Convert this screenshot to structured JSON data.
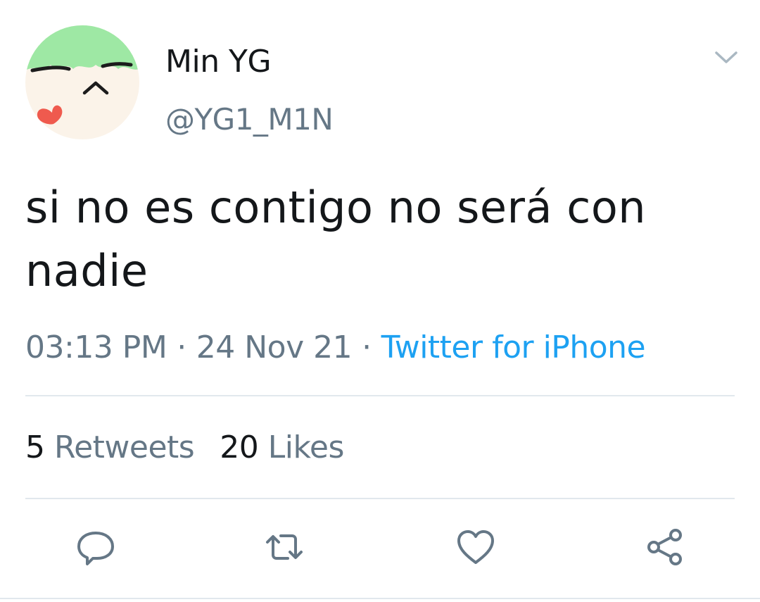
{
  "tweet": {
    "display_name": "Min YG",
    "handle": "@YG1_M1N",
    "text": "si no es contigo no será con nadie",
    "time": "03:13 PM",
    "date": "24 Nov 21",
    "separator": "·",
    "source": "Twitter for iPhone",
    "retweets_count": "5",
    "retweets_label": "Retweets",
    "likes_count": "20",
    "likes_label": "Likes"
  },
  "icons": {
    "avatar": "avatar-image",
    "menu": "chevron-down-icon",
    "reply": "reply-icon",
    "retweet": "retweet-icon",
    "like": "heart-icon",
    "share": "share-icon"
  },
  "colors": {
    "text": "#14171a",
    "secondary": "#657786",
    "link": "#1da1f2",
    "divider": "#e1e8ed"
  }
}
